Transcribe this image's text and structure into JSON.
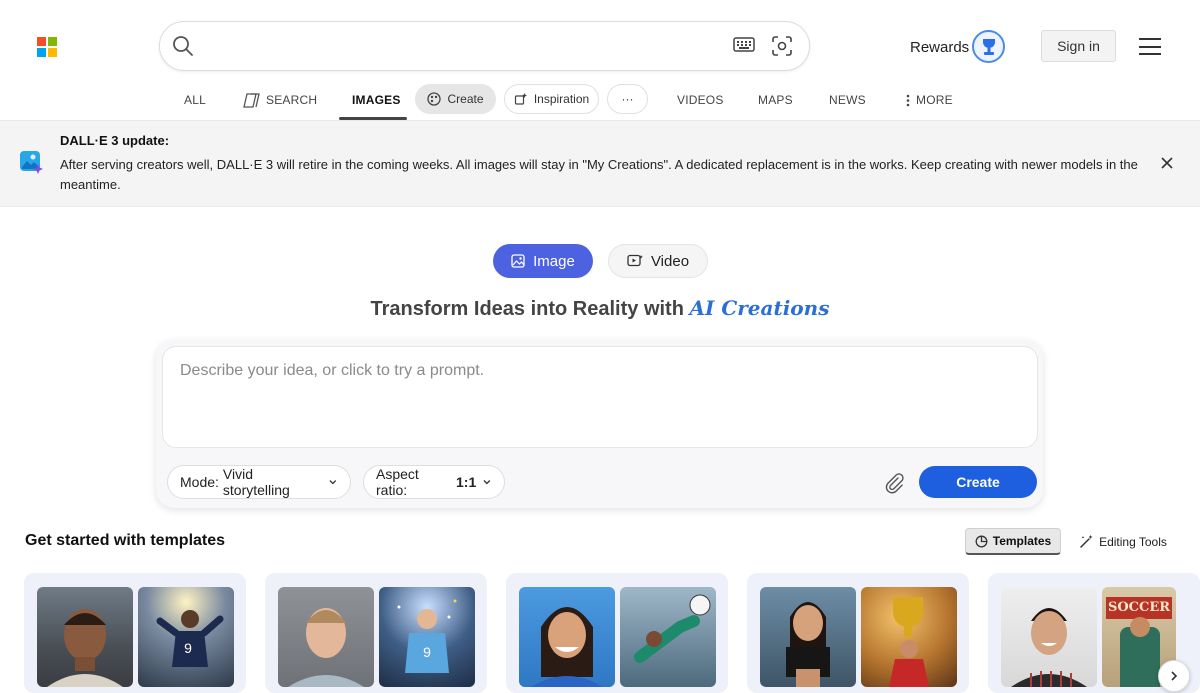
{
  "header": {
    "search_placeholder": "",
    "rewards_label": "Rewards",
    "signin_label": "Sign in",
    "logo_colors": [
      "#f25022",
      "#7fba00",
      "#00a4ef",
      "#ffb900"
    ]
  },
  "tabs": {
    "all": "ALL",
    "search": "SEARCH",
    "images": "IMAGES",
    "create": "Create",
    "inspiration": "Inspiration",
    "more_dots": "···",
    "videos": "VIDEOS",
    "maps": "MAPS",
    "news": "NEWS",
    "more": "MORE",
    "active": "IMAGES"
  },
  "banner": {
    "title": "DALL·E 3 update:",
    "text": "After serving creators well, DALL·E 3 will retire in the coming weeks. All images will stay in \"My Creations\". A dedicated replacement is in the works. Keep creating with newer models in the meantime."
  },
  "mode_toggle": {
    "image_label": "Image",
    "video_label": "Video",
    "selected": "Image"
  },
  "headline": {
    "main": "Transform Ideas into Reality with ",
    "accent": "AI Creations"
  },
  "composer": {
    "prompt_placeholder": "Describe your idea, or click to try a prompt.",
    "mode_label": "Mode:",
    "mode_value": "Vivid storytelling",
    "aspect_label": "Aspect ratio:",
    "aspect_value": "1:1",
    "create_label": "Create"
  },
  "templates": {
    "heading": "Get started with templates",
    "templates_button": "Templates",
    "editing_tools_button": "Editing Tools",
    "cards": [
      {
        "sign_text": ""
      },
      {
        "sign_text": ""
      },
      {
        "sign_text": ""
      },
      {
        "sign_text": ""
      },
      {
        "sign_text": "SOCCER"
      }
    ]
  },
  "colors": {
    "accent_blue": "#1e5fdf",
    "image_toggle": "#4d62e0",
    "ai_text": "#2c6fd4"
  }
}
